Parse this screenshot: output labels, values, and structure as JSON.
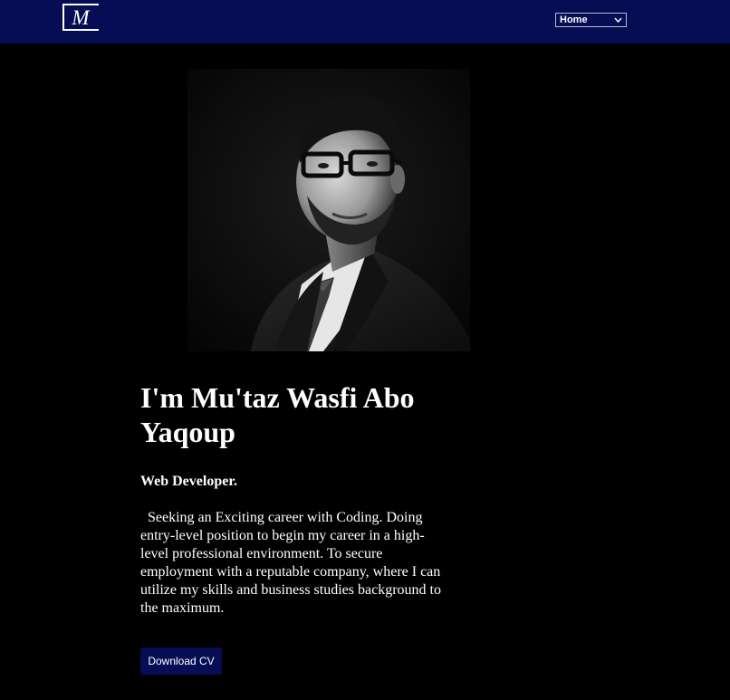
{
  "header": {
    "logo": {
      "letter": "M",
      "icon": "monogram-logo-icon"
    },
    "nav_select": {
      "selected": "Home",
      "icon": "chevron-down-icon"
    },
    "background_color": "#070d55"
  },
  "hero": {
    "portrait": {
      "kind": "black-and-white photo of a man in glasses, suit and tie"
    },
    "name": "I'm Mu'taz Wasfi Abo Yaqoup",
    "role": "Web Developer.",
    "bio": "  Seeking an Exciting career with Coding. Doing entry-level position to begin my career in a high-level professional environment. To secure employment with a reputable company, where I can utilize my skills and business studies background to the maximum.",
    "download_label": "Download CV"
  },
  "colors": {
    "page_background": "#000000",
    "accent": "#070d55",
    "text": "#ffffff"
  }
}
